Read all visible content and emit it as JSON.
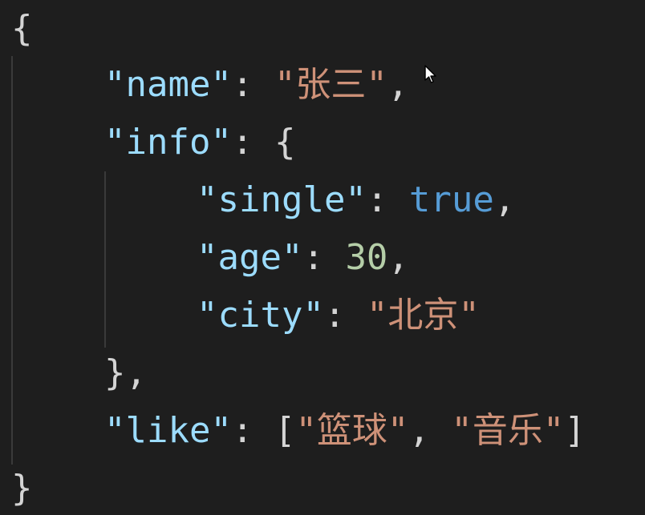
{
  "code": {
    "open_brace": "{",
    "close_brace": "}",
    "name_key": "\"name\"",
    "name_value": "\"张三\"",
    "info_key": "\"info\"",
    "single_key": "\"single\"",
    "single_value": "true",
    "age_key": "\"age\"",
    "age_value": "30",
    "city_key": "\"city\"",
    "city_value": "\"北京\"",
    "info_close": "}",
    "like_key": "\"like\"",
    "like_item_1": "\"篮球\"",
    "like_item_2": "\"音乐\""
  },
  "colors": {
    "background": "#1e1e1e",
    "key": "#9cdcfe",
    "string": "#ce9178",
    "boolean": "#569cd6",
    "number": "#b5cea8",
    "punctuation": "#d4d4d4"
  },
  "icons": {
    "pointer": "mouse-pointer-icon"
  }
}
